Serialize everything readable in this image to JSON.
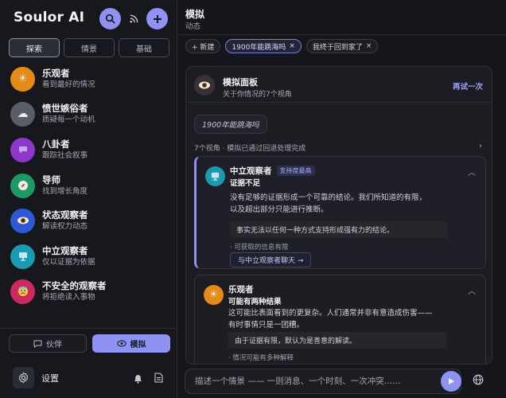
{
  "sidebar": {
    "brand": "Soulor AI",
    "tabs": [
      {
        "label": "探索"
      },
      {
        "label": "情景"
      },
      {
        "label": "基础"
      }
    ],
    "personas": [
      {
        "name": "乐观者",
        "desc": "看到最好的情况",
        "icon": "sun-icon",
        "color": "#e38a17"
      },
      {
        "name": "愤世嫉俗者",
        "desc": "质疑每一个动机",
        "icon": "storm-cloud-icon",
        "color": "#5a5d68"
      },
      {
        "name": "八卦者",
        "desc": "跟踪社会叙事",
        "icon": "speech-bubble-icon",
        "color": "#8d38c9"
      },
      {
        "name": "导师",
        "desc": "找到增长角度",
        "icon": "compass-icon",
        "color": "#1d9a64"
      },
      {
        "name": "状态观察者",
        "desc": "解读权力动态",
        "icon": "eye-icon",
        "color": "#2f58d4"
      },
      {
        "name": "中立观察者",
        "desc": "仅以证据为依据",
        "icon": "monitor-icon",
        "color": "#1a9bb0"
      },
      {
        "name": "不安全的观察者",
        "desc": "将拒绝读入事物",
        "icon": "anxious-face-icon",
        "color": "#cc2a5c"
      }
    ],
    "mode_partner": "伙伴",
    "mode_simulate": "模拟",
    "settings_label": "设置"
  },
  "main": {
    "title": "模拟",
    "subtitle": "动态",
    "new_chip": "+ 新建",
    "chips": [
      {
        "label": "1900年能跳海吗",
        "selected": true
      },
      {
        "label": "我终于回到家了",
        "selected": false
      }
    ],
    "panel": {
      "title": "模拟面板",
      "subtitle": "关于你情况的7个视角",
      "retry": "再试一次",
      "question": "1900年能跳海吗",
      "views_status": "7个视角 · 模拟已通过回退处理完成"
    },
    "cards": [
      {
        "name": "中立观察者",
        "badge": "支持度最高",
        "verdict": "证据不足",
        "body_line1": "没有足够的证据形成一个可靠的结论。我们所知道的有限，",
        "body_line2": "以及超出部分只能进行推断。",
        "quote": "事实无法以任何一种方式支持形成强有力的结论。",
        "bullet": "· 可获取的信息有限",
        "chat_label": "与中立观察者聊天 →"
      },
      {
        "name": "乐观者",
        "verdict": "可能有两种结果",
        "body_line1": "这可能比表面看到的更复杂。人们通常并非有意造成伤害——",
        "body_line2": "有时事情只是一团糟。",
        "quote": "由于证据有限，默认为是善意的解读。",
        "bullet": "· 情况可能有多种解释"
      }
    ],
    "input_placeholder": "描述一个情景 —— 一则消息、一个时刻、一次冲突……"
  }
}
